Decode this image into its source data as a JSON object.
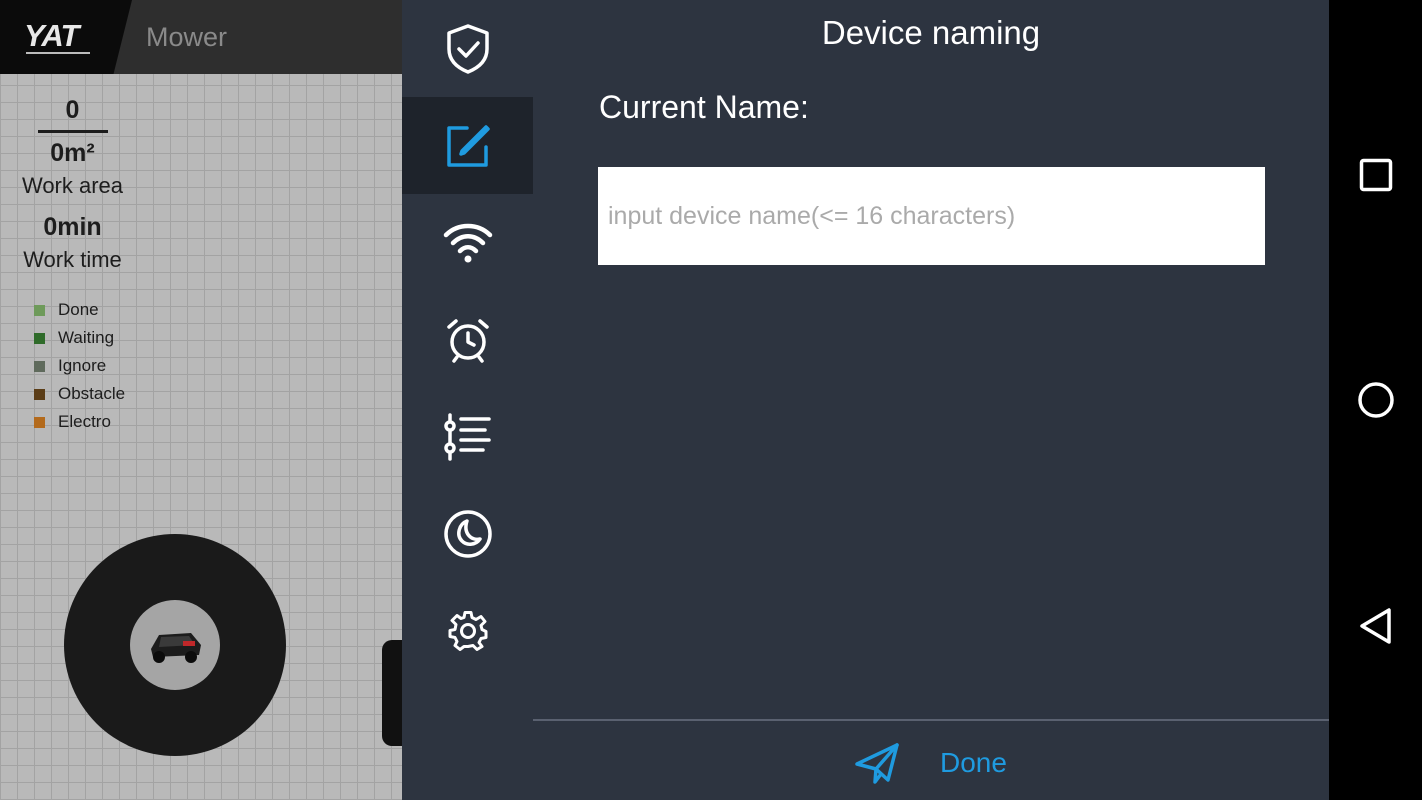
{
  "app": {
    "logo_text": "YAT",
    "title": "Mower"
  },
  "stats": {
    "count": "0",
    "area": "0m²",
    "area_label": "Work area",
    "time": "0min",
    "time_label": "Work time"
  },
  "legend": [
    {
      "label": "Done",
      "color": "#6e9a5a"
    },
    {
      "label": "Waiting",
      "color": "#2f6b2a"
    },
    {
      "label": "Ignore",
      "color": "#5f6a5c"
    },
    {
      "label": "Obstacle",
      "color": "#5b3d17"
    },
    {
      "label": "Electro",
      "color": "#b36a1c"
    }
  ],
  "side_nav": [
    {
      "icon": "shield-check-icon",
      "active": false
    },
    {
      "icon": "edit-icon",
      "active": true
    },
    {
      "icon": "wifi-icon",
      "active": false
    },
    {
      "icon": "alarm-clock-icon",
      "active": false
    },
    {
      "icon": "sliders-list-icon",
      "active": false
    },
    {
      "icon": "moon-icon",
      "active": false
    },
    {
      "icon": "gear-icon",
      "active": false
    }
  ],
  "dialog": {
    "title": "Device naming",
    "current_name_label": "Current Name:",
    "input": {
      "value": "",
      "placeholder": "input device name(<= 16 characters)"
    },
    "done_label": "Done"
  },
  "colors": {
    "accent": "#1f9be0",
    "panel_bg": "#2d3440",
    "active_nav_bg": "#1e232b"
  },
  "android_nav": [
    "recents-icon",
    "home-icon",
    "back-icon"
  ]
}
